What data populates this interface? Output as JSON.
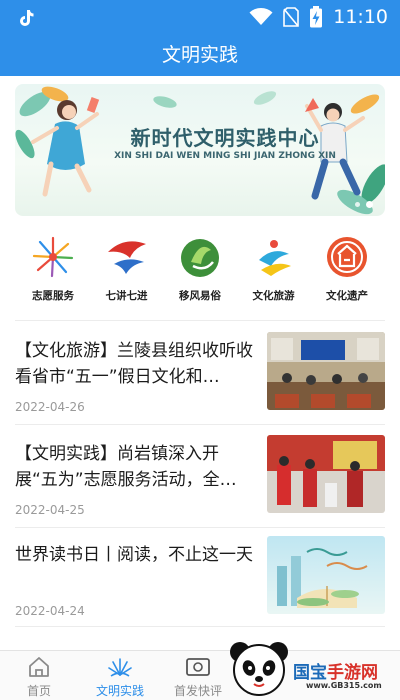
{
  "status_bar": {
    "time": "11:10"
  },
  "header": {
    "title": "文明实践"
  },
  "banner": {
    "title": "新时代文明实践中心",
    "subtitle": "XIN SHI DAI WEN MING SHI JIAN ZHONG XIN"
  },
  "categories": [
    {
      "label": "志愿服务",
      "icon": "volunteer-icon"
    },
    {
      "label": "七讲七进",
      "icon": "seven-lectures-icon"
    },
    {
      "label": "移风易俗",
      "icon": "customs-icon"
    },
    {
      "label": "文化旅游",
      "icon": "culture-tourism-icon"
    },
    {
      "label": "文化遗产",
      "icon": "heritage-icon"
    }
  ],
  "news": [
    {
      "headline": "【文化旅游】兰陵县组织收听收看省市“五一”假日文化和…",
      "date": "2022-04-26"
    },
    {
      "headline": "【文明实践】尚岩镇深入开展“五为”志愿服务活动，全…",
      "date": "2022-04-25"
    },
    {
      "headline": "世界读书日丨阅读，不止这一天",
      "date": "2022-04-24"
    }
  ],
  "bottom_nav": [
    {
      "label": "首页",
      "active": false
    },
    {
      "label": "文明实践",
      "active": true
    },
    {
      "label": "首发快评",
      "active": false
    }
  ],
  "watermark": {
    "brand_blue": "国宝",
    "brand_red": "手游网",
    "url": "www.GB315.com"
  },
  "colors": {
    "accent": "#2e8fe9",
    "text": "#1c1c1c",
    "date": "#9a9a9a"
  }
}
